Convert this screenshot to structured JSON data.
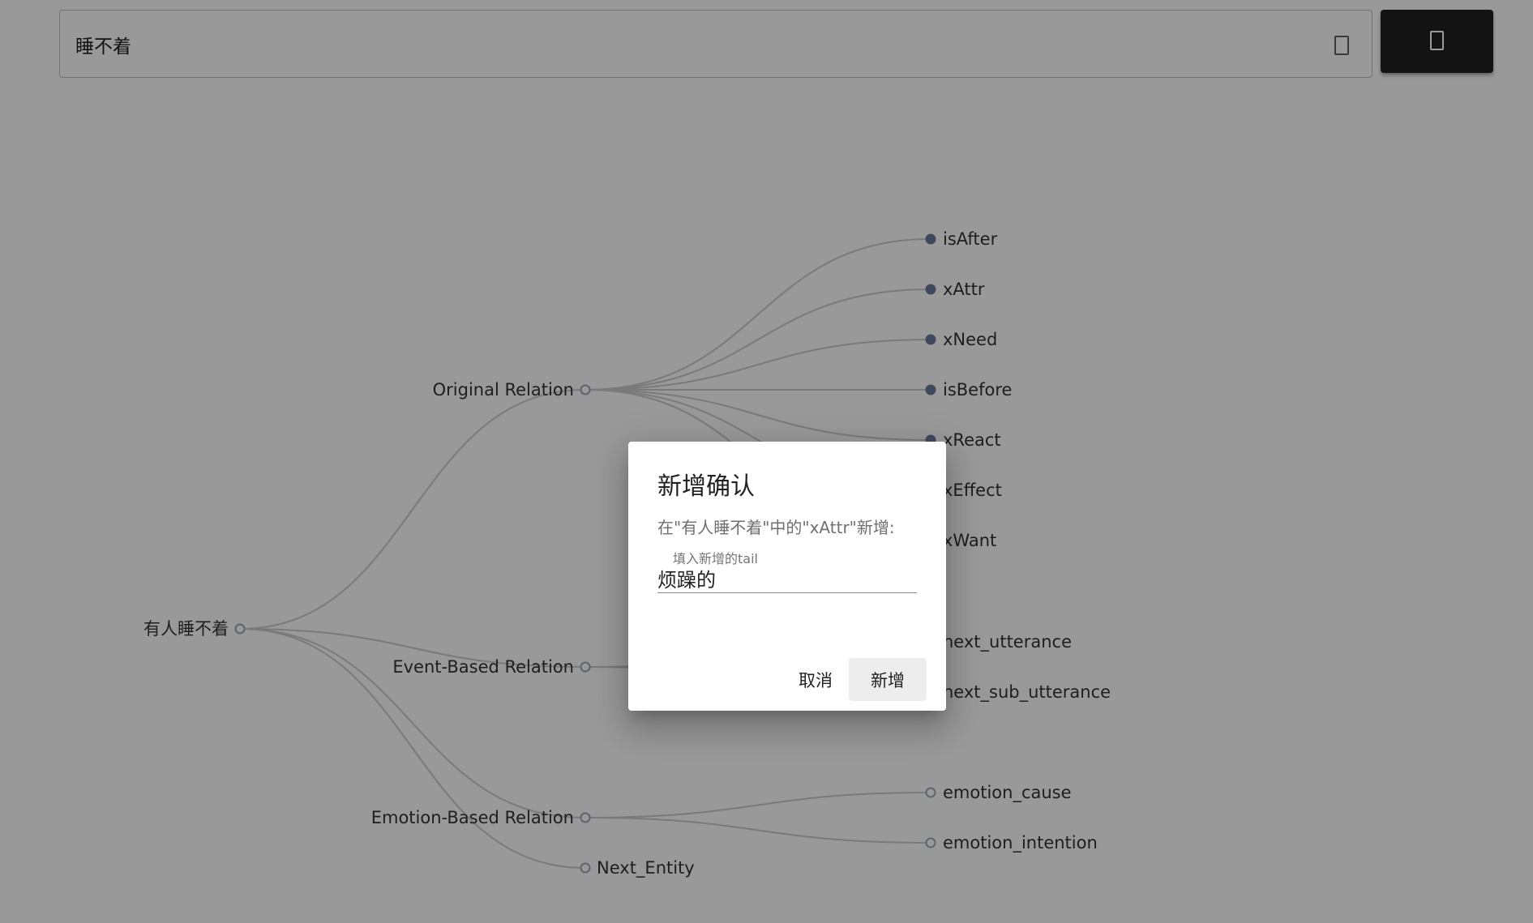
{
  "search": {
    "value": "睡不着",
    "placeholder": "",
    "clear_icon": "clear-icon",
    "button_icon": "search-icon"
  },
  "tree": {
    "root": "有人睡不着",
    "categories": [
      {
        "label": "Original Relation",
        "children": [
          "isAfter",
          "xAttr",
          "xNeed",
          "isBefore",
          "xReact",
          "xEffect",
          "xWant"
        ]
      },
      {
        "label": "Event-Based Relation",
        "children": [
          "next_utterance",
          "next_sub_utterance"
        ]
      },
      {
        "label": "Emotion-Based Relation",
        "children": [
          "emotion_cause",
          "emotion_intention"
        ]
      },
      {
        "label": "Next_Entity",
        "children": []
      }
    ],
    "colors": {
      "link": "#cccccc",
      "node_filled": "#6c7a9a",
      "node_hollow": "#9aa6bd"
    }
  },
  "dialog": {
    "title": "新增确认",
    "message": "在\"有人睡不着\"中的\"xAttr\"新增:",
    "field_label": "填入新增的tail",
    "field_value": "烦躁的",
    "cancel_label": "取消",
    "confirm_label": "新增"
  }
}
